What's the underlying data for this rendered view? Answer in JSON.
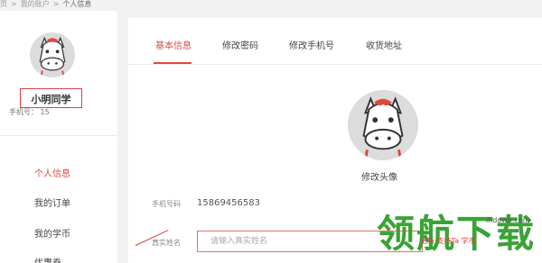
{
  "breadcrumb": {
    "home": "页",
    "account": "我的账户",
    "current": "个人信息"
  },
  "profile": {
    "name": "小明同学",
    "phone_label": "手机号：",
    "phone_partial": "15"
  },
  "nav": {
    "items": [
      {
        "label": "个人信息",
        "active": true
      },
      {
        "label": "我的订单"
      },
      {
        "label": "我的学币"
      },
      {
        "label": "优惠券"
      }
    ]
  },
  "tabs": [
    {
      "label": "基本信息",
      "active": true
    },
    {
      "label": "修改密码"
    },
    {
      "label": "修改手机号"
    },
    {
      "label": "收货地址"
    }
  ],
  "form": {
    "change_avatar": "修改头像",
    "phone_label": "手机号码",
    "phone_value": "15869456583",
    "name_label": "真实姓名",
    "name_placeholder": "请输入真实姓名"
  },
  "watermark": {
    "main": "领航下载",
    "domain": "ihdown.com",
    "tag": "更新  支持Ta  学币"
  },
  "colors": {
    "accent": "#e0483e",
    "watermark": "#3aa335"
  }
}
